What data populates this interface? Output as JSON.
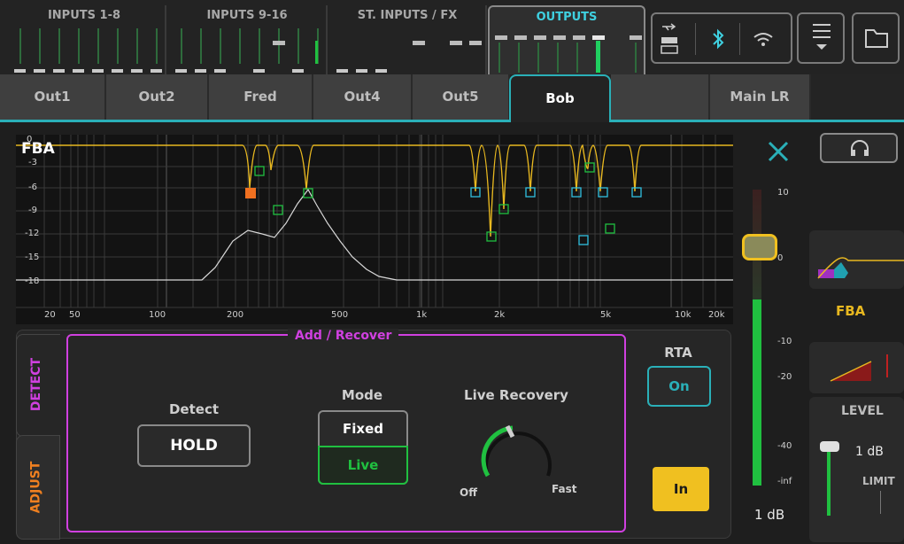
{
  "banks": [
    {
      "label": "INPUTS 1-8"
    },
    {
      "label": "INPUTS 9-16"
    },
    {
      "label": "ST. INPUTS / FX"
    },
    {
      "label": "OUTPUTS"
    }
  ],
  "tabs": [
    "Out1",
    "Out2",
    "Fred",
    "Out4",
    "Out5",
    "Bob",
    "",
    "Main LR"
  ],
  "active_tab": "Bob",
  "graph": {
    "title": "FBA",
    "y_labels": [
      "0",
      "-3",
      "-6",
      "-9",
      "-12",
      "-15",
      "-18"
    ],
    "x_labels": [
      "20",
      "50",
      "100",
      "200",
      "500",
      "1k",
      "2k",
      "5k",
      "10k",
      "20k"
    ]
  },
  "panel": {
    "side_tabs": {
      "detect": "DETECT",
      "adjust": "ADJUST"
    },
    "group_title": "Add / Recover",
    "detect_label": "Detect",
    "detect_button": "HOLD",
    "mode_label": "Mode",
    "mode_options": [
      "Fixed",
      "Live"
    ],
    "mode_selected": "Live",
    "live_recovery_label": "Live Recovery",
    "knob_min": "Off",
    "knob_max": "Fast",
    "rta_label": "RTA",
    "rta_button": "On",
    "in_button": "In"
  },
  "fader": {
    "scale": [
      "10",
      "0",
      "-10",
      "-20",
      "-40",
      "-inf"
    ],
    "value": "1 dB"
  },
  "right_panel": {
    "fba_logo": "FBA",
    "level_label": "LEVEL",
    "level_value": "1 dB",
    "limit_label": "LIMIT"
  },
  "colors": {
    "accent": "#2ab0b8",
    "detect": "#d040e0",
    "adjust": "#f08020",
    "live": "#20c040",
    "in_button": "#f0c020",
    "curve": "#e8b820"
  }
}
